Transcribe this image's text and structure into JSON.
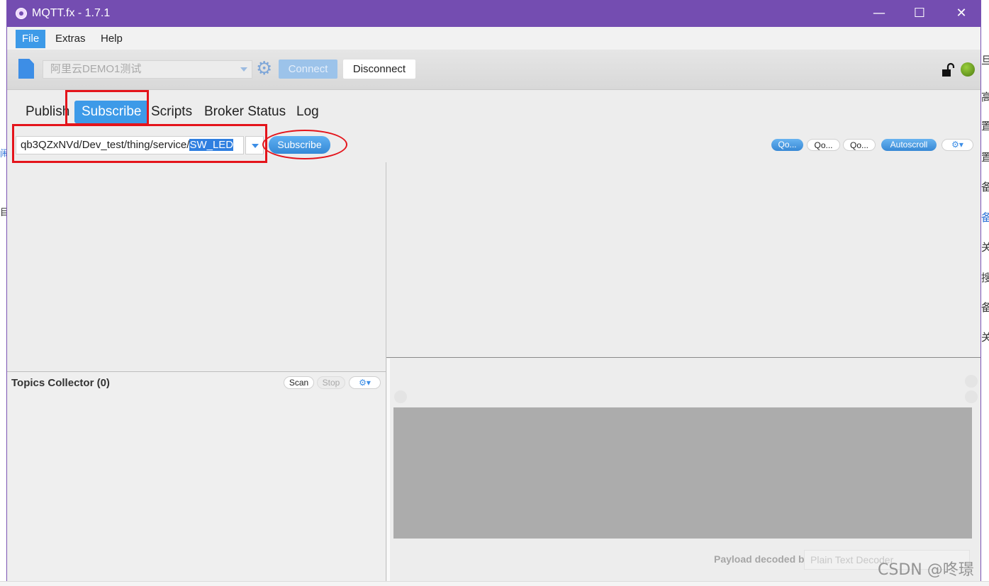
{
  "window": {
    "title": "MQTT.fx - 1.7.1",
    "controls": {
      "minimize": "—",
      "maximize": "☐",
      "close": "✕"
    }
  },
  "menu": {
    "items": [
      "File",
      "Extras",
      "Help"
    ],
    "active": "File"
  },
  "toolbar": {
    "profile": "阿里云DEMO1测试",
    "connect_label": "Connect",
    "disconnect_label": "Disconnect",
    "status_color": "#6fa524",
    "lock_icon": "unlocked-padlock-icon"
  },
  "tabs": {
    "items": [
      "Publish",
      "Subscribe",
      "Scripts",
      "Broker Status",
      "Log"
    ],
    "active": "Subscribe"
  },
  "subscribe": {
    "topic_prefix": "qb3QZxNVd/Dev_test/thing/service/",
    "topic_selected": "SW_LED",
    "button_label": "Subscribe"
  },
  "right_controls": {
    "qos0": "Qo...",
    "qos1": "Qo...",
    "qos2": "Qo...",
    "autoscroll": "Autoscroll",
    "options_icon": "⚙▾"
  },
  "topics_collector": {
    "title": "Topics Collector (0)",
    "scan_label": "Scan",
    "stop_label": "Stop",
    "options_icon": "⚙▾"
  },
  "payload": {
    "decoded_by_label": "Payload decoded by",
    "decoder": "Plain Text Decoder"
  },
  "background_page": {
    "left_chars": [
      "闹",
      "目、"
    ],
    "right_chars": [
      "旦",
      "高",
      "置",
      "置",
      "备",
      "备",
      "关",
      "搜",
      "备",
      "关"
    ]
  },
  "watermark": "CSDN @咚璟",
  "colors": {
    "titlebar": "#744db1",
    "accent": "#3d9ae8",
    "annotation_red": "#e4141b"
  }
}
